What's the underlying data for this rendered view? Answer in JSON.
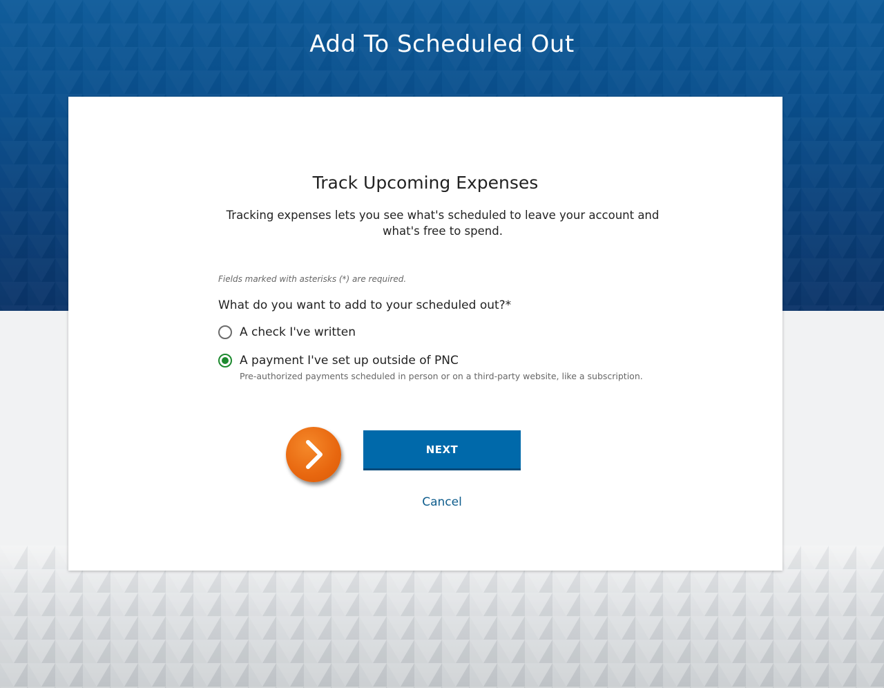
{
  "header": {
    "title": "Add To Scheduled Out"
  },
  "card": {
    "heading": "Track Upcoming Expenses",
    "description": "Tracking expenses lets you see what's scheduled to leave your account and what's free to spend.",
    "required_note": "Fields marked with asterisks (*) are required.",
    "question": "What do you want to add to your scheduled out?*",
    "options": [
      {
        "label": "A check I've written",
        "selected": false
      },
      {
        "label": "A payment I've set up outside of PNC",
        "sublabel": "Pre-authorized payments scheduled in person or on a third-party website, like a subscription.",
        "selected": true
      }
    ],
    "next_label": "NEXT",
    "cancel_label": "Cancel"
  },
  "colors": {
    "brand_blue": "#0069aa",
    "header_blue": "#0a4f8c",
    "selected_green": "#1d8a2f",
    "pointer_orange": "#e8670f",
    "link_blue": "#0d5c8c"
  },
  "icons": {
    "pointer": "chevron-right-icon"
  }
}
